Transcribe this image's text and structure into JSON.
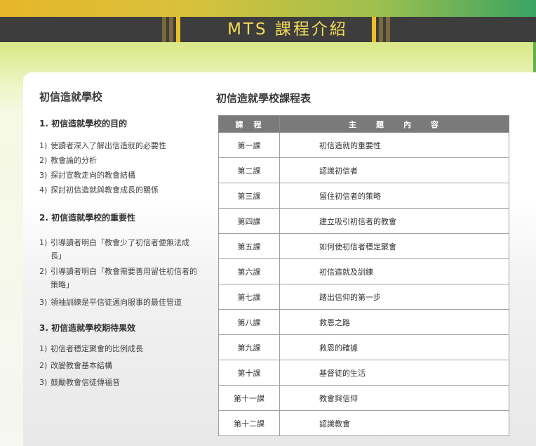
{
  "header": {
    "title": "MTS 課程介紹"
  },
  "left": {
    "title": "初信造就學校",
    "sections": [
      {
        "heading": "1.  初信造就學校的目的",
        "items": [
          {
            "num": "1)",
            "lines": [
              "使讀者深入了解出信造就的必要性"
            ]
          },
          {
            "num": "2)",
            "lines": [
              "教會論的分析"
            ]
          },
          {
            "num": "3)",
            "lines": [
              "探討宣教走向的教會結構"
            ]
          },
          {
            "num": "4)",
            "lines": [
              "探討初信造就與教會成長的關係"
            ]
          }
        ]
      },
      {
        "heading": "2.  初信造就學校的重要性",
        "items": [
          {
            "num": "1)",
            "lines": [
              "引導讀者明白「教會少了初信者便無法成",
              "長」"
            ]
          },
          {
            "num": "2)",
            "lines": [
              "引導讀者明白「教會需要善用留住初信者的",
              "策略」"
            ]
          },
          {
            "num": "3)",
            "lines": [
              "領袖訓練是平信徒邁向服事的最佳管道"
            ]
          }
        ]
      },
      {
        "heading": "3.  初信造就學校期待果效",
        "items": [
          {
            "num": "1)",
            "lines": [
              "初信者穩定聚會的比例成長"
            ]
          },
          {
            "num": "2)",
            "lines": [
              "改變教會基本結構"
            ]
          },
          {
            "num": "3)",
            "lines": [
              "鼓勵教會信徒傳福音"
            ]
          }
        ]
      }
    ]
  },
  "schedule": {
    "title": "初信造就學校課程表",
    "headers": [
      "課　程",
      "主　　題　　內　　容"
    ],
    "rows": [
      [
        "第一課",
        "初信造就的重要性"
      ],
      [
        "第二課",
        "認識初信者"
      ],
      [
        "第三課",
        "留住初信者的策略"
      ],
      [
        "第四課",
        "建立吸引初信者的教會"
      ],
      [
        "第五課",
        "如何使初信者穩定聚會"
      ],
      [
        "第六課",
        "初信造就及訓練"
      ],
      [
        "第七課",
        "踏出信仰的第一步"
      ],
      [
        "第八課",
        "救恩之路"
      ],
      [
        "第九課",
        "救恩的確據"
      ],
      [
        "第十課",
        "基督徒的生活"
      ],
      [
        "第十一課",
        "教會與信仰"
      ],
      [
        "第十二課",
        "認識教會"
      ]
    ]
  }
}
